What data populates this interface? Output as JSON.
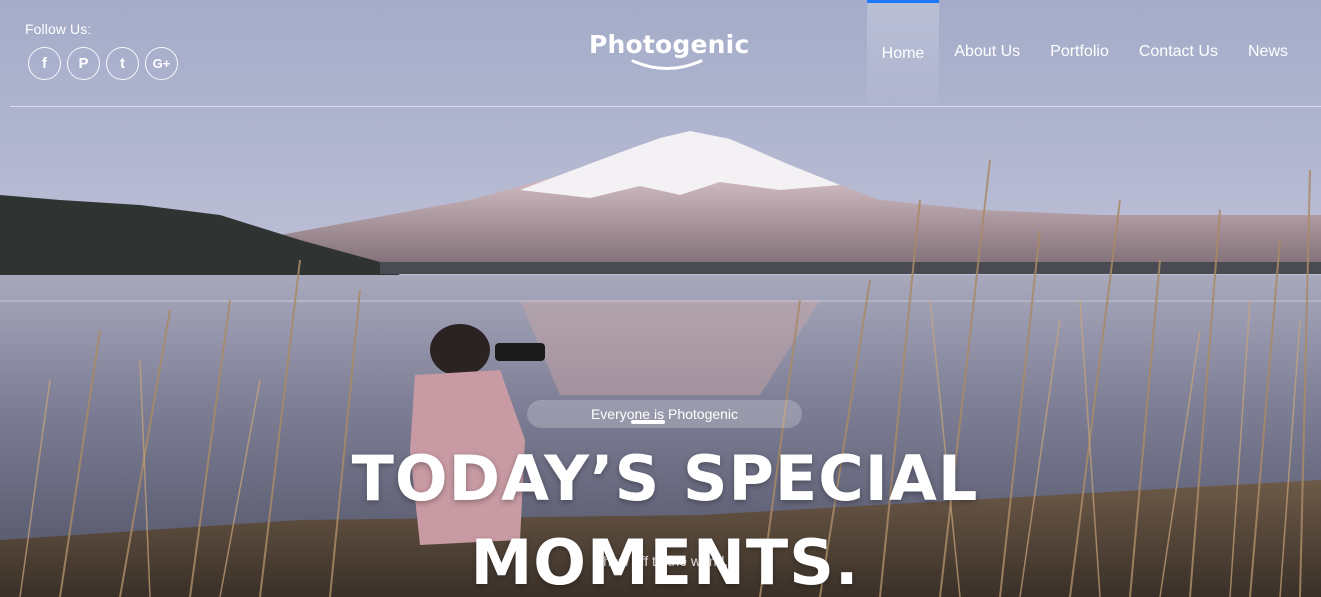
{
  "header": {
    "follow_label": "Follow Us:",
    "socials": [
      {
        "name": "facebook-icon",
        "glyph": "f"
      },
      {
        "name": "pinterest-icon",
        "glyph": "P"
      },
      {
        "name": "twitter-icon",
        "glyph": "t"
      },
      {
        "name": "google-plus-icon",
        "glyph": "G+"
      }
    ],
    "logo_text": "Photogenic"
  },
  "nav": {
    "items": [
      {
        "label": "Home",
        "active": true
      },
      {
        "label": "About Us",
        "active": false
      },
      {
        "label": "Portfolio",
        "active": false
      },
      {
        "label": "Contact Us",
        "active": false
      },
      {
        "label": "News",
        "active": false
      }
    ],
    "active_color": "#1e78ff"
  },
  "hero": {
    "tagline": "Everyone is Photogenic",
    "headline_line1": "TODAY’S SPECIAL",
    "headline_line2": "MOMENTS.",
    "subtext": "Show off to the world..."
  }
}
